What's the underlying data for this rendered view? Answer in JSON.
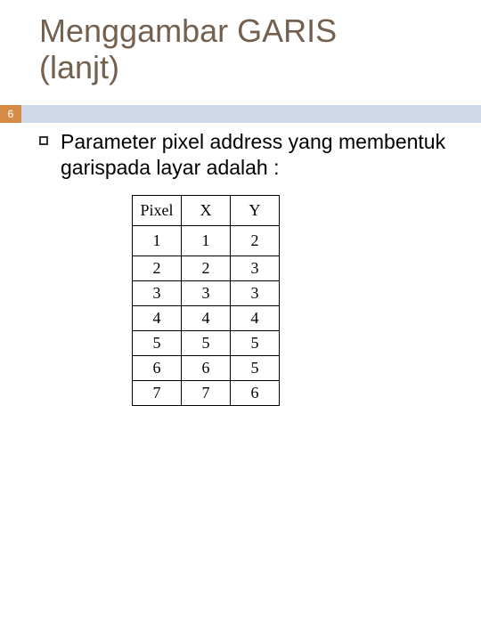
{
  "slide": {
    "title_line1": "Menggambar GARIS",
    "title_line2": "(lanjt)",
    "page_number": "6",
    "paragraph": "Parameter pixel address yang membentuk garispada layar adalah :"
  },
  "chart_data": {
    "type": "table",
    "title": "",
    "headers": [
      "Pixel",
      "X",
      "Y"
    ],
    "rows": [
      [
        "1",
        "1",
        "2"
      ],
      [
        "2",
        "2",
        "3"
      ],
      [
        "3",
        "3",
        "3"
      ],
      [
        "4",
        "4",
        "4"
      ],
      [
        "5",
        "5",
        "5"
      ],
      [
        "6",
        "6",
        "5"
      ],
      [
        "7",
        "7",
        "6"
      ]
    ]
  }
}
